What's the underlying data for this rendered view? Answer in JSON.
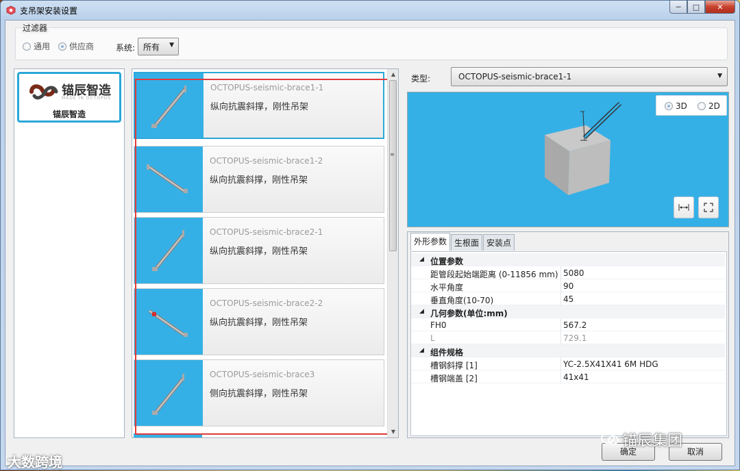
{
  "window": {
    "title": "支吊架安装设置",
    "min": "─",
    "max": "□",
    "close": "✕"
  },
  "filter": {
    "legend": "过滤器",
    "radio_general": "通用",
    "radio_supplier": "供应商",
    "system_label": "系统:",
    "system_value": "所有"
  },
  "brand": {
    "name": "锚辰智造",
    "sub": "MADE IN OCTOPUS",
    "caption": "锚辰智造"
  },
  "list": {
    "items": [
      {
        "name": "OCTOPUS-seismic-brace1-1",
        "desc": "纵向抗震斜撑，刚性吊架"
      },
      {
        "name": "OCTOPUS-seismic-brace1-2",
        "desc": "纵向抗震斜撑，刚性吊架"
      },
      {
        "name": "OCTOPUS-seismic-brace2-1",
        "desc": "纵向抗震斜撑，刚性吊架"
      },
      {
        "name": "OCTOPUS-seismic-brace2-2",
        "desc": "纵向抗震斜撑，刚性吊架"
      },
      {
        "name": "OCTOPUS-seismic-brace3",
        "desc": "侧向抗震斜撑，刚性吊架"
      }
    ]
  },
  "type": {
    "label": "类型:",
    "value": "OCTOPUS-seismic-brace1-1"
  },
  "view": {
    "opt3d": "3D",
    "opt2d": "2D",
    "selected": "3D"
  },
  "props": {
    "tabs": [
      "外形参数",
      "生根面",
      "安装点"
    ],
    "groups": [
      {
        "title": "位置参数",
        "rows": [
          {
            "k": "距管段起始端距离 (0-11856 mm)",
            "v": "5080"
          },
          {
            "k": "水平角度",
            "v": "90"
          },
          {
            "k": "垂直角度(10-70)",
            "v": "45"
          }
        ]
      },
      {
        "title": "几何参数(单位:mm)",
        "rows": [
          {
            "k": "FH0",
            "v": "567.2"
          },
          {
            "k": "L",
            "v": "729.1"
          }
        ]
      },
      {
        "title": "组件规格",
        "rows": [
          {
            "k": "槽钢斜撑 [1]",
            "v": "YC-2.5X41X41 6M HDG"
          },
          {
            "k": "槽钢端盖 [2]",
            "v": "41x41"
          }
        ]
      }
    ]
  },
  "buttons": {
    "ok": "确定",
    "cancel": "取消"
  },
  "watermarks": {
    "right": "锚辰集团",
    "left": "大数跨境"
  }
}
